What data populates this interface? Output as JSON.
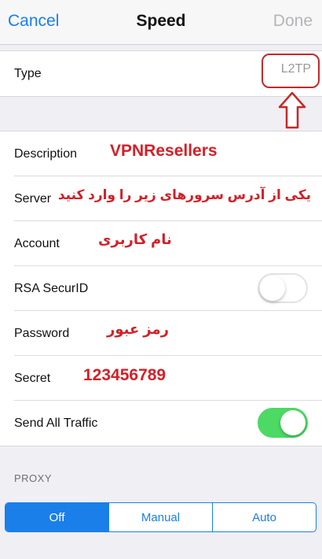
{
  "navbar": {
    "cancel_label": "Cancel",
    "title": "Speed",
    "done_label": "Done"
  },
  "type_row": {
    "label": "Type",
    "value": "L2TP"
  },
  "rows": {
    "description": {
      "label": "Description",
      "annotation": "VPNResellers"
    },
    "server": {
      "label": "Server",
      "annotation": "یکی از آدرس سرورهای زیر را وارد کنید"
    },
    "account": {
      "label": "Account",
      "annotation": "نام کاربری"
    },
    "rsa": {
      "label": "RSA SecurID",
      "toggle_on": false
    },
    "password": {
      "label": "Password",
      "annotation": "رمز عبور"
    },
    "secret": {
      "label": "Secret",
      "annotation": "123456789"
    },
    "send_all": {
      "label": "Send All Traffic",
      "toggle_on": true
    }
  },
  "proxy": {
    "header": "PROXY",
    "options": [
      "Off",
      "Manual",
      "Auto"
    ],
    "selected": "Off"
  },
  "colors": {
    "accent": "#1a7fe8",
    "annotation_red": "#d32027",
    "toggle_green": "#4cd964"
  }
}
